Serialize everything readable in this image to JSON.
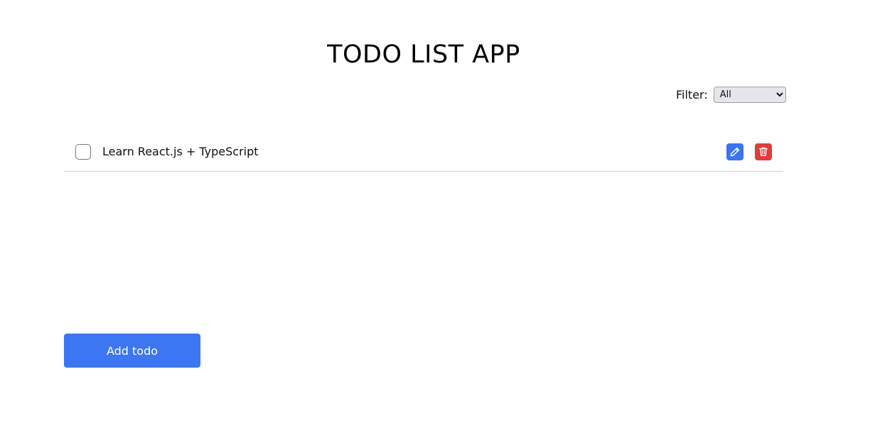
{
  "header": {
    "title": "TODO LIST APP"
  },
  "filter": {
    "label": "Filter:",
    "selected": "All"
  },
  "todos": [
    {
      "text": "Learn React.js + TypeScript",
      "completed": false
    }
  ],
  "actions": {
    "add_label": "Add todo"
  },
  "colors": {
    "primary": "#3c76f2",
    "edit": "#3b74f0",
    "delete": "#e23c3c",
    "divider": "#cfcfcf"
  }
}
